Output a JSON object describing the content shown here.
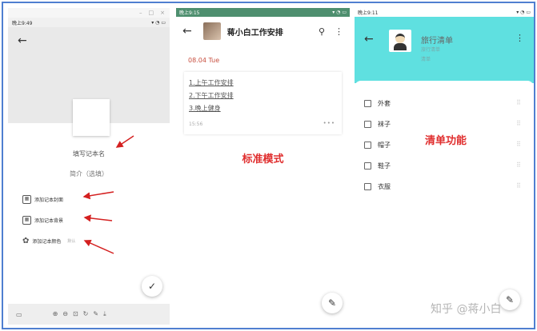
{
  "panel1": {
    "window_controls": [
      "–",
      "□",
      "×"
    ],
    "status_time": "晚上9:49",
    "back_icon": "arrow-left-icon",
    "name_placeholder": "填写记本名",
    "intro_placeholder": "简介（选填）",
    "options": [
      {
        "label": "添加记本封面",
        "icon": "image-add-icon"
      },
      {
        "label": "添加记本背景",
        "icon": "image-add-icon"
      },
      {
        "label": "添加记本颜色",
        "icon": "palette-icon",
        "value": "默认"
      }
    ],
    "confirm_icon": "check-icon",
    "toolbar_icon": "screen-icon",
    "zoom_tools": [
      "⊕",
      "⊖",
      "⊡",
      "↻",
      "✎",
      "⤓"
    ]
  },
  "panel2": {
    "status_time": "晚上9:15",
    "title": "蒋小白工作安排",
    "date": "08.04 Tue",
    "lines": [
      "1.上午工作安排",
      "2.下午工作安排",
      "3.晚上健身"
    ],
    "time": "15:56",
    "caption": "标准模式"
  },
  "panel3": {
    "status_time": "晚上9:11",
    "title": "旅行清单",
    "sub1": "旅行清单",
    "sub2": "清单",
    "items": [
      "外套",
      "袜子",
      "帽子",
      "鞋子",
      "衣服"
    ],
    "caption": "清单功能",
    "watermark": "知乎 @蒋小白"
  },
  "colors": {
    "frame": "#4f7fd0",
    "panel2_status": "#4e8f6f",
    "panel3_header": "#5fe0e0",
    "caption_red": "#e02e2e",
    "date_red": "#c85040",
    "arrow_red": "#d42020"
  }
}
